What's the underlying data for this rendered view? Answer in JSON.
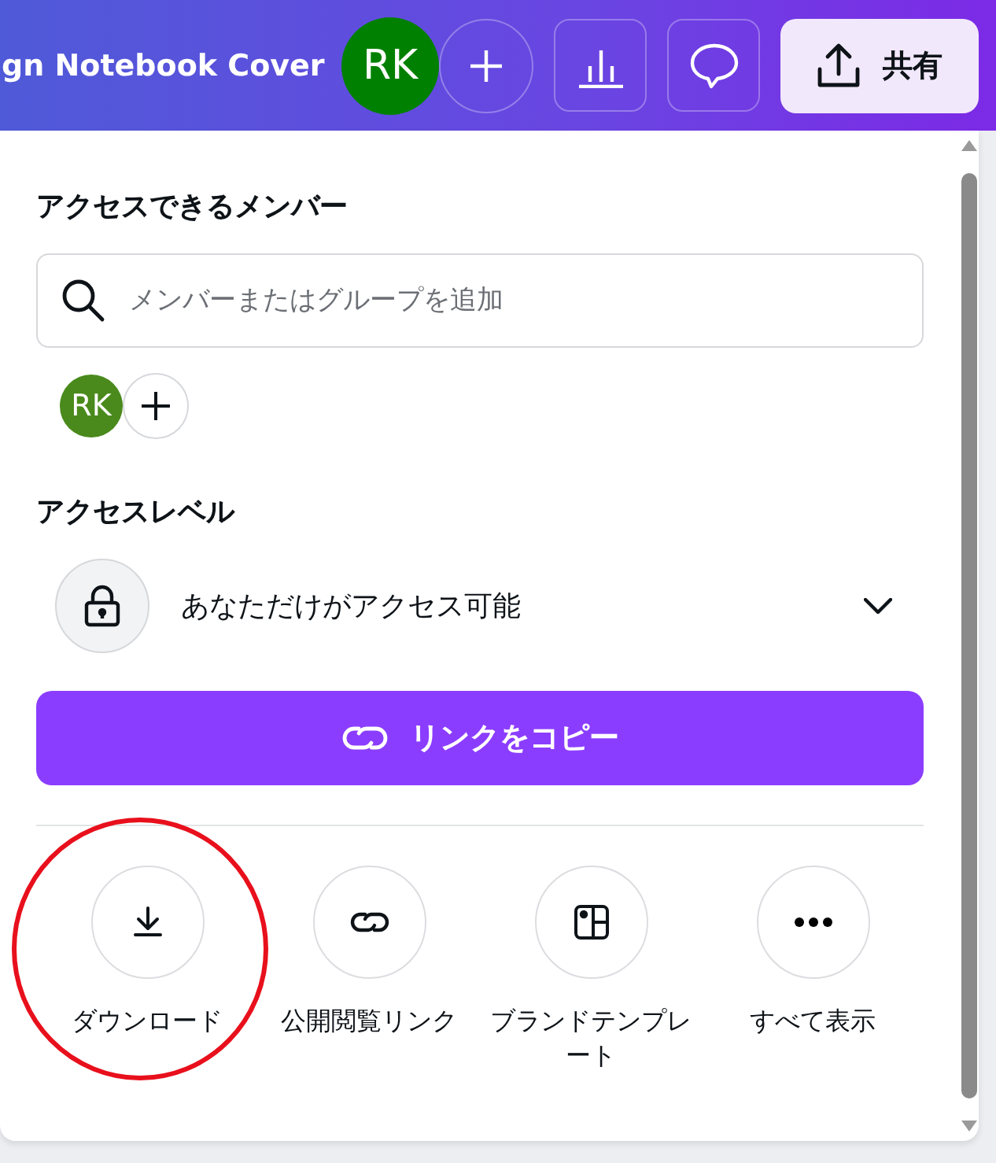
{
  "header": {
    "title": "gn Notebook Cover",
    "avatar": {
      "initials": "RK",
      "color": "#008000"
    },
    "share_button": {
      "label": "共有"
    }
  },
  "members": {
    "heading": "アクセスできるメンバー",
    "search": {
      "placeholder": "メンバーまたはグループを追加"
    },
    "avatars": [
      {
        "initials": "RK",
        "color": "#4a8a1c"
      }
    ]
  },
  "access": {
    "heading": "アクセスレベル",
    "value": "あなただけがアクセス可能"
  },
  "copy_button": {
    "label": "リンクをコピー"
  },
  "actions": [
    {
      "kind": "download",
      "label": "ダウンロード",
      "circled": true
    },
    {
      "kind": "link",
      "label": "公開閲覧リンク",
      "circled": false
    },
    {
      "kind": "template",
      "label": "ブランドテンプレート",
      "circled": false
    },
    {
      "kind": "more",
      "label": "すべて表示",
      "circled": false
    }
  ]
}
